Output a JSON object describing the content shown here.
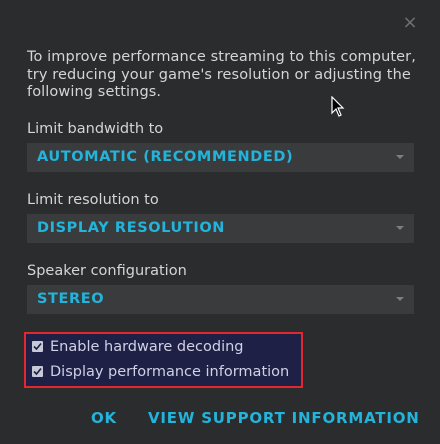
{
  "dialog": {
    "close_glyph": "×",
    "intro_text": "To improve performance streaming to this computer, try reducing your game's resolution or adjusting the following settings."
  },
  "fields": [
    {
      "label": "Limit bandwidth to",
      "value": "AUTOMATIC (RECOMMENDED)"
    },
    {
      "label": "Limit resolution to",
      "value": "DISPLAY RESOLUTION"
    },
    {
      "label": "Speaker configuration",
      "value": "STEREO"
    }
  ],
  "checkboxes": [
    {
      "label": "Enable hardware decoding",
      "checked": true
    },
    {
      "label": "Display performance information",
      "checked": true
    }
  ],
  "footer": {
    "ok_label": "OK",
    "support_label": "VIEW SUPPORT INFORMATION"
  },
  "colors": {
    "accent": "#23b4dc",
    "highlight_border": "#e0282e",
    "background": "#2b2c2e"
  },
  "icons": {
    "close": "close-icon",
    "dropdown": "chevron-down-icon",
    "checkmark": "checkmark-icon",
    "pointer": "mouse-pointer-icon"
  }
}
